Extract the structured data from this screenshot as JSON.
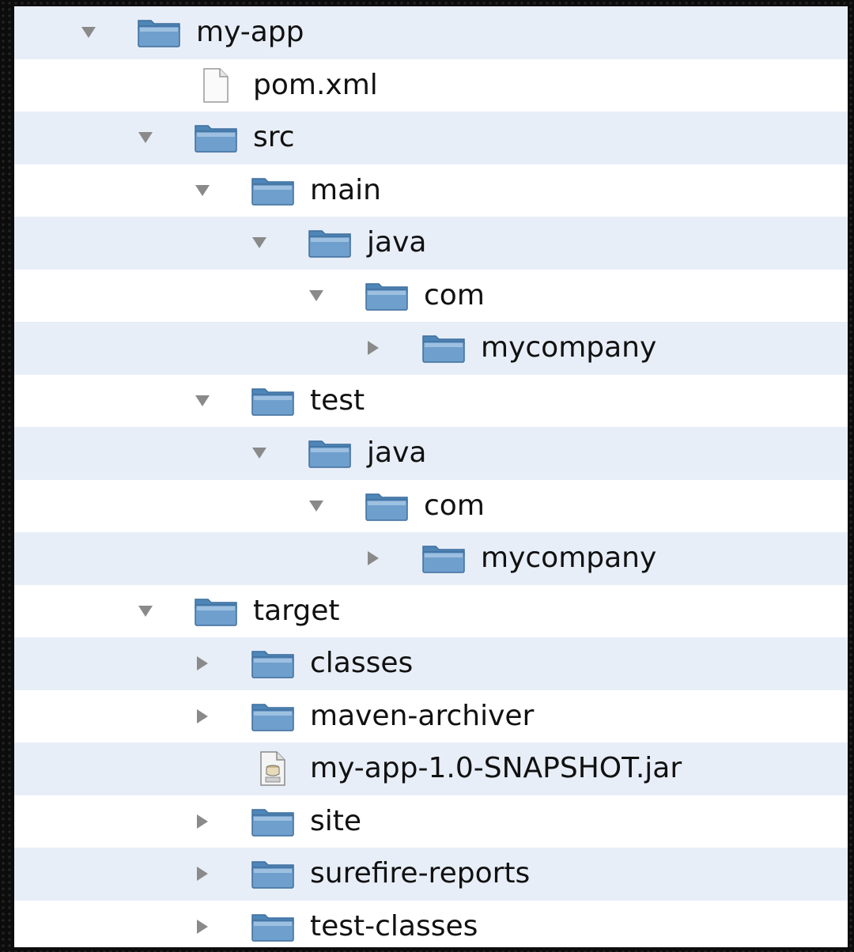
{
  "tree": {
    "rows": [
      {
        "label": "my-app",
        "level": 0,
        "type": "folder",
        "toggle": "expanded"
      },
      {
        "label": "pom.xml",
        "level": 1,
        "type": "file",
        "toggle": "none"
      },
      {
        "label": "src",
        "level": 1,
        "type": "folder",
        "toggle": "expanded"
      },
      {
        "label": "main",
        "level": 2,
        "type": "folder",
        "toggle": "expanded"
      },
      {
        "label": "java",
        "level": 3,
        "type": "folder",
        "toggle": "expanded"
      },
      {
        "label": "com",
        "level": 4,
        "type": "folder",
        "toggle": "expanded"
      },
      {
        "label": "mycompany",
        "level": 5,
        "type": "folder",
        "toggle": "collapsed"
      },
      {
        "label": "test",
        "level": 2,
        "type": "folder",
        "toggle": "expanded"
      },
      {
        "label": "java",
        "level": 3,
        "type": "folder",
        "toggle": "expanded"
      },
      {
        "label": "com",
        "level": 4,
        "type": "folder",
        "toggle": "expanded"
      },
      {
        "label": "mycompany",
        "level": 5,
        "type": "folder",
        "toggle": "collapsed"
      },
      {
        "label": "target",
        "level": 1,
        "type": "folder",
        "toggle": "expanded"
      },
      {
        "label": "classes",
        "level": 2,
        "type": "folder",
        "toggle": "collapsed"
      },
      {
        "label": "maven-archiver",
        "level": 2,
        "type": "folder",
        "toggle": "collapsed"
      },
      {
        "label": "my-app-1.0-SNAPSHOT.jar",
        "level": 2,
        "type": "jar",
        "toggle": "none"
      },
      {
        "label": "site",
        "level": 2,
        "type": "folder",
        "toggle": "collapsed"
      },
      {
        "label": "surefire-reports",
        "level": 2,
        "type": "folder",
        "toggle": "collapsed"
      },
      {
        "label": "test-classes",
        "level": 2,
        "type": "folder",
        "toggle": "collapsed"
      }
    ]
  },
  "icons": {
    "folder": "folder-icon",
    "file": "document-icon",
    "jar": "jar-file-icon",
    "expanded": "disclosure-triangle-down-icon",
    "collapsed": "disclosure-triangle-right-icon"
  },
  "colors": {
    "row_alt": "#e8eef8",
    "row_plain": "#ffffff",
    "folder_blue": "#6f9fcc",
    "text": "#111111",
    "triangle": "#8a8a8a"
  }
}
